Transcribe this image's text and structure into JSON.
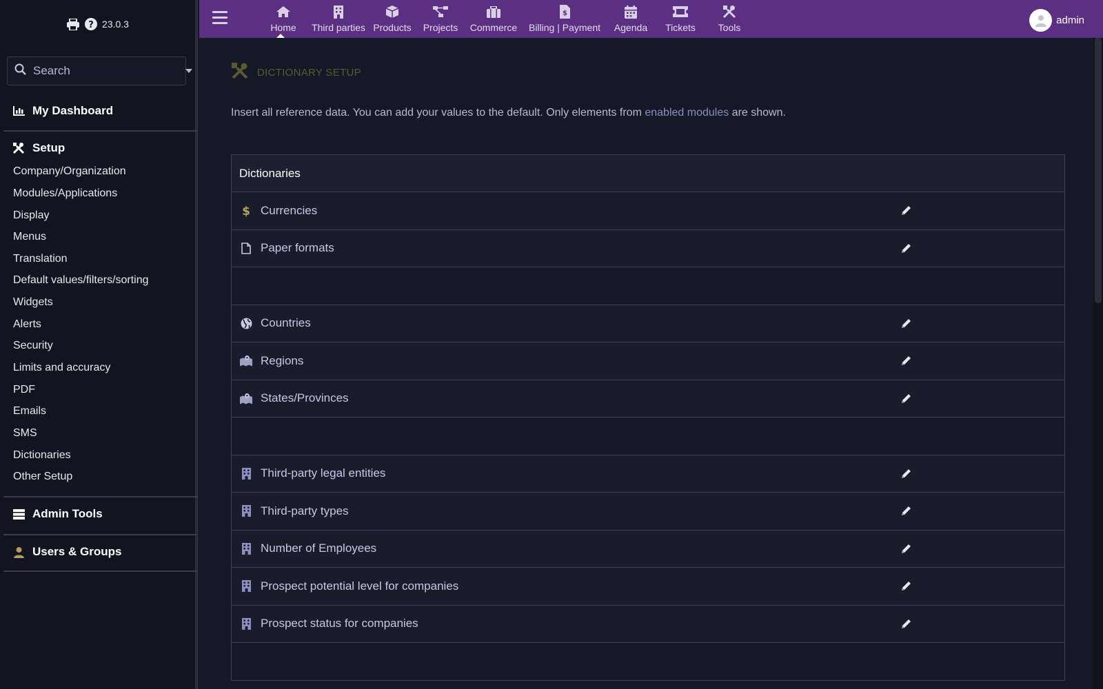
{
  "sidebar": {
    "version": "23.0.3",
    "search_placeholder": "Search",
    "dashboard_label": "My Dashboard",
    "setup": {
      "label": "Setup",
      "items": [
        "Company/Organization",
        "Modules/Applications",
        "Display",
        "Menus",
        "Translation",
        "Default values/filters/sorting",
        "Widgets",
        "Alerts",
        "Security",
        "Limits and accuracy",
        "PDF",
        "Emails",
        "SMS",
        "Dictionaries",
        "Other Setup"
      ]
    },
    "admin_tools_label": "Admin Tools",
    "users_groups_label": "Users & Groups"
  },
  "topnav": {
    "items": [
      {
        "label": "Home",
        "icon": "home-icon"
      },
      {
        "label": "Third parties",
        "icon": "building-icon"
      },
      {
        "label": "Products",
        "icon": "cube-icon"
      },
      {
        "label": "Projects",
        "icon": "project-icon"
      },
      {
        "label": "Commerce",
        "icon": "briefcase-icon"
      },
      {
        "label": "Billing | Payment",
        "icon": "invoice-icon"
      },
      {
        "label": "Agenda",
        "icon": "calendar-icon"
      },
      {
        "label": "Tickets",
        "icon": "ticket-icon"
      },
      {
        "label": "Tools",
        "icon": "tools-icon"
      }
    ],
    "active": "Home",
    "user_name": "admin"
  },
  "main": {
    "title": "DICTIONARY SETUP",
    "intro_before": "Insert all reference data. You can add your values to the default. Only elements from ",
    "intro_link": "enabled modules",
    "intro_after": " are shown.",
    "table_header": "Dictionaries",
    "rows": [
      {
        "label": "Currencies",
        "icon": "dollar-icon"
      },
      {
        "label": "Paper formats",
        "icon": "file-icon"
      },
      {
        "label": "",
        "icon": ""
      },
      {
        "label": "Countries",
        "icon": "globe-icon"
      },
      {
        "label": "Regions",
        "icon": "map-icon"
      },
      {
        "label": "States/Provinces",
        "icon": "map-icon"
      },
      {
        "label": "",
        "icon": ""
      },
      {
        "label": "Third-party legal entities",
        "icon": "building-icon"
      },
      {
        "label": "Third-party types",
        "icon": "building-icon"
      },
      {
        "label": "Number of Employees",
        "icon": "building-icon"
      },
      {
        "label": "Prospect potential level for companies",
        "icon": "building-icon"
      },
      {
        "label": "Prospect status for companies",
        "icon": "building-icon"
      },
      {
        "label": "",
        "icon": ""
      }
    ]
  },
  "colors": {
    "topbar": "#5b2f82",
    "sidebar_bg": "#12151f",
    "page_bg": "#141827",
    "title_color": "#5c5a2b",
    "link_color": "#8a8fc4"
  }
}
